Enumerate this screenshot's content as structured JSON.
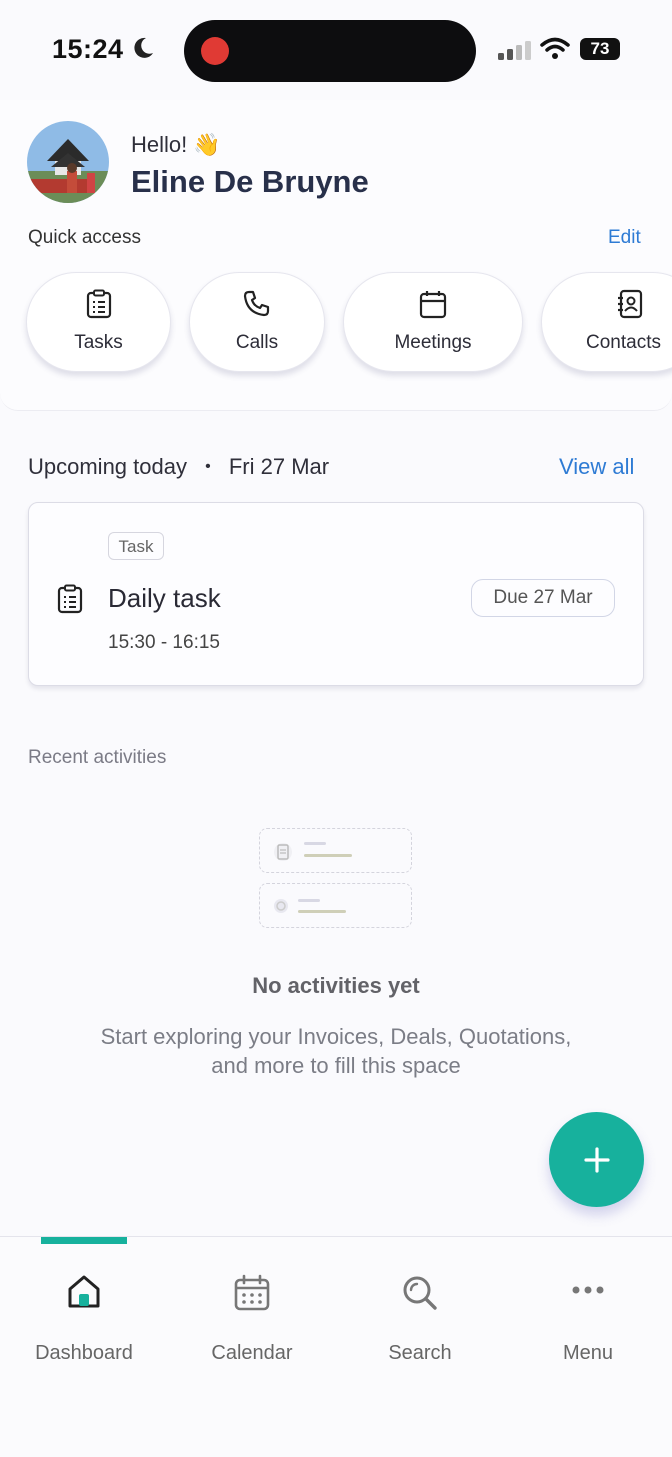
{
  "status_bar": {
    "time": "15:24",
    "battery": "73"
  },
  "header": {
    "greeting": "Hello! 👋",
    "user_name": "Eline De Bruyne"
  },
  "quick_access": {
    "label": "Quick access",
    "edit_label": "Edit",
    "items": [
      {
        "label": "Tasks",
        "icon": "clipboard-icon"
      },
      {
        "label": "Calls",
        "icon": "phone-icon"
      },
      {
        "label": "Meetings",
        "icon": "calendar-icon"
      },
      {
        "label": "Contacts",
        "icon": "contact-book-icon"
      }
    ]
  },
  "upcoming": {
    "title": "Upcoming today",
    "separator": "•",
    "date": "Fri 27 Mar",
    "view_all_label": "View all",
    "task": {
      "tag": "Task",
      "title": "Daily task",
      "due": "Due 27 Mar",
      "time": "15:30 - 16:15"
    }
  },
  "recent": {
    "title": "Recent activities",
    "empty_title": "No activities yet",
    "empty_description": "Start exploring your Invoices, Deals, Quotations, and more to fill this space"
  },
  "fab": {
    "icon": "plus-icon"
  },
  "bottom_nav": {
    "items": [
      {
        "label": "Dashboard",
        "icon": "home-icon",
        "active": true
      },
      {
        "label": "Calendar",
        "icon": "calendar-icon"
      },
      {
        "label": "Search",
        "icon": "search-icon"
      },
      {
        "label": "Menu",
        "icon": "more-icon"
      }
    ]
  },
  "colors": {
    "accent": "#17b19d",
    "link": "#2e7bd4",
    "title": "#28304a"
  }
}
